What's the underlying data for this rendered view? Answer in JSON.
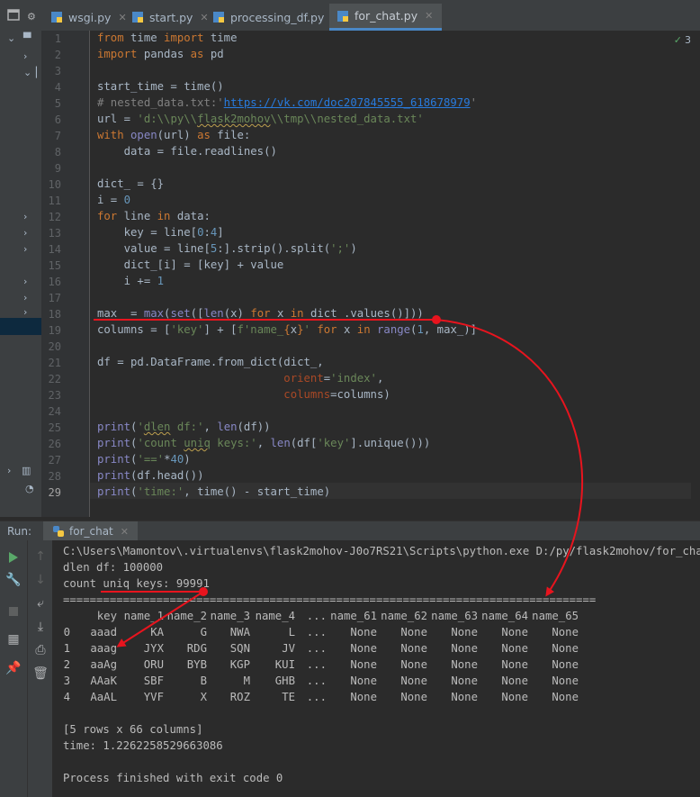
{
  "tabs": [
    {
      "label": "wsgi.py",
      "active": false
    },
    {
      "label": "start.py",
      "active": false
    },
    {
      "label": "processing_df.py",
      "active": false
    },
    {
      "label": "for_chat.py",
      "active": true
    }
  ],
  "inspection": {
    "count": "3"
  },
  "line_numbers": [
    "1",
    "2",
    "3",
    "4",
    "5",
    "6",
    "7",
    "8",
    "9",
    "10",
    "11",
    "12",
    "13",
    "14",
    "15",
    "16",
    "17",
    "18",
    "19",
    "20",
    "21",
    "22",
    "23",
    "24",
    "25",
    "26",
    "27",
    "28",
    "29"
  ],
  "code": {
    "l1": {
      "a": "from",
      "b": " time ",
      "c": "import",
      "d": " time"
    },
    "l2": {
      "a": "import",
      "b": " pandas ",
      "c": "as",
      "d": " pd"
    },
    "l4": "start_time = time()",
    "l5": {
      "a": "# nested_data.txt:'",
      "b": "https://vk.com/doc207845555_618678979",
      "c": "'"
    },
    "l6": {
      "a": "url = ",
      "b": "'d:\\\\py\\\\",
      "c": "flask2mohov",
      "d": "\\\\tmp\\\\nested_data.txt'"
    },
    "l7": {
      "a": "with",
      "b": " ",
      "c": "open",
      "d": "(url) ",
      "e": "as",
      "f": " file:"
    },
    "l8": "    data = file.readlines()",
    "l10": "dict_ = {}",
    "l11": {
      "a": "i = ",
      "b": "0"
    },
    "l12": {
      "a": "for",
      "b": " line ",
      "c": "in",
      "d": " data:"
    },
    "l13": {
      "a": "    key = line[",
      "b": "0",
      "c": ":",
      "d": "4",
      "e": "]"
    },
    "l14": {
      "a": "    value = line[",
      "b": "5",
      "c": ":].strip().split(",
      "d": "';'",
      "e": ")"
    },
    "l15": "    dict_[i] = [key] + value",
    "l16": {
      "a": "    i += ",
      "b": "1"
    },
    "l18": {
      "a": "max_ = ",
      "b": "max",
      "c": "(",
      "d": "set",
      "e": "([",
      "f": "len",
      "g": "(x) ",
      "h": "for",
      "i": " x ",
      "j": "in",
      "k": " dict_.values()]))"
    },
    "l19": {
      "a": "columns = [",
      "b": "'key'",
      "c": "] + [",
      "d": "f'name_",
      "e": "{",
      "f": "x",
      "g": "}",
      "h": "'",
      "i": " ",
      "j": "for",
      "k": " x ",
      "l": "in",
      "m": " ",
      "n": "range",
      "o": "(",
      "p": "1",
      "q": ", max_)]"
    },
    "l21": "df = pd.DataFrame.from_dict(dict_,",
    "l22": {
      "a": "                            ",
      "b": "orient",
      "c": "=",
      "d": "'index'",
      "e": ","
    },
    "l23": {
      "a": "                            ",
      "b": "columns",
      "c": "=columns)"
    },
    "l25": {
      "a": "print",
      "b": "(",
      "c": "'",
      "d": "dlen",
      "e": " df:'",
      "f": ", ",
      "g": "len",
      "h": "(df))"
    },
    "l26": {
      "a": "print",
      "b": "(",
      "c": "'count ",
      "d": "uniq",
      "e": " keys:'",
      "f": ", ",
      "g": "len",
      "h": "(df[",
      "i": "'key'",
      "j": "].unique()))"
    },
    "l27": {
      "a": "print",
      "b": "(",
      "c": "'=='",
      "d": "*",
      "e": "40",
      "f": ")"
    },
    "l28": {
      "a": "print",
      "b": "(df.head())"
    },
    "l29": {
      "a": "print",
      "b": "(",
      "c": "'time:'",
      "d": ", time() - start_time)"
    }
  },
  "run": {
    "label": "Run:",
    "tab": "for_chat",
    "cmd": "C:\\Users\\Mamontov\\.virtualenvs\\flask2mohov-J0o7RS21\\Scripts\\python.exe D:/py/flask2mohov/for_chat.py",
    "dlen": "dlen df: 100000",
    "count": "count uniq keys: 99991",
    "sep": "================================================================================",
    "header": [
      "",
      "key",
      "name_1",
      "name_2",
      "name_3",
      "name_4",
      "...",
      "name_61",
      "name_62",
      "name_63",
      "name_64",
      "name_65"
    ],
    "rows": [
      [
        "0",
        "aaad",
        "KA",
        "G",
        "NWA",
        "L",
        "...",
        "None",
        "None",
        "None",
        "None",
        "None"
      ],
      [
        "1",
        "aaag",
        "JYX",
        "RDG",
        "SQN",
        "JV",
        "...",
        "None",
        "None",
        "None",
        "None",
        "None"
      ],
      [
        "2",
        "aaAg",
        "ORU",
        "BYB",
        "KGP",
        "KUI",
        "...",
        "None",
        "None",
        "None",
        "None",
        "None"
      ],
      [
        "3",
        "AAaK",
        "SBF",
        "B",
        "M",
        "GHB",
        "...",
        "None",
        "None",
        "None",
        "None",
        "None"
      ],
      [
        "4",
        "AaAL",
        "YVF",
        "X",
        "ROZ",
        "TE",
        "...",
        "None",
        "None",
        "None",
        "None",
        "None"
      ]
    ],
    "shape": "[5 rows x 66 columns]",
    "time": "time: 1.2262258529663086",
    "exit": "Process finished with exit code 0"
  },
  "colors": {
    "editor_bg": "#2b2b2b",
    "keyword": "#cc7832",
    "string": "#6a8759",
    "number": "#6897bb",
    "annotation": "#e8141e"
  }
}
